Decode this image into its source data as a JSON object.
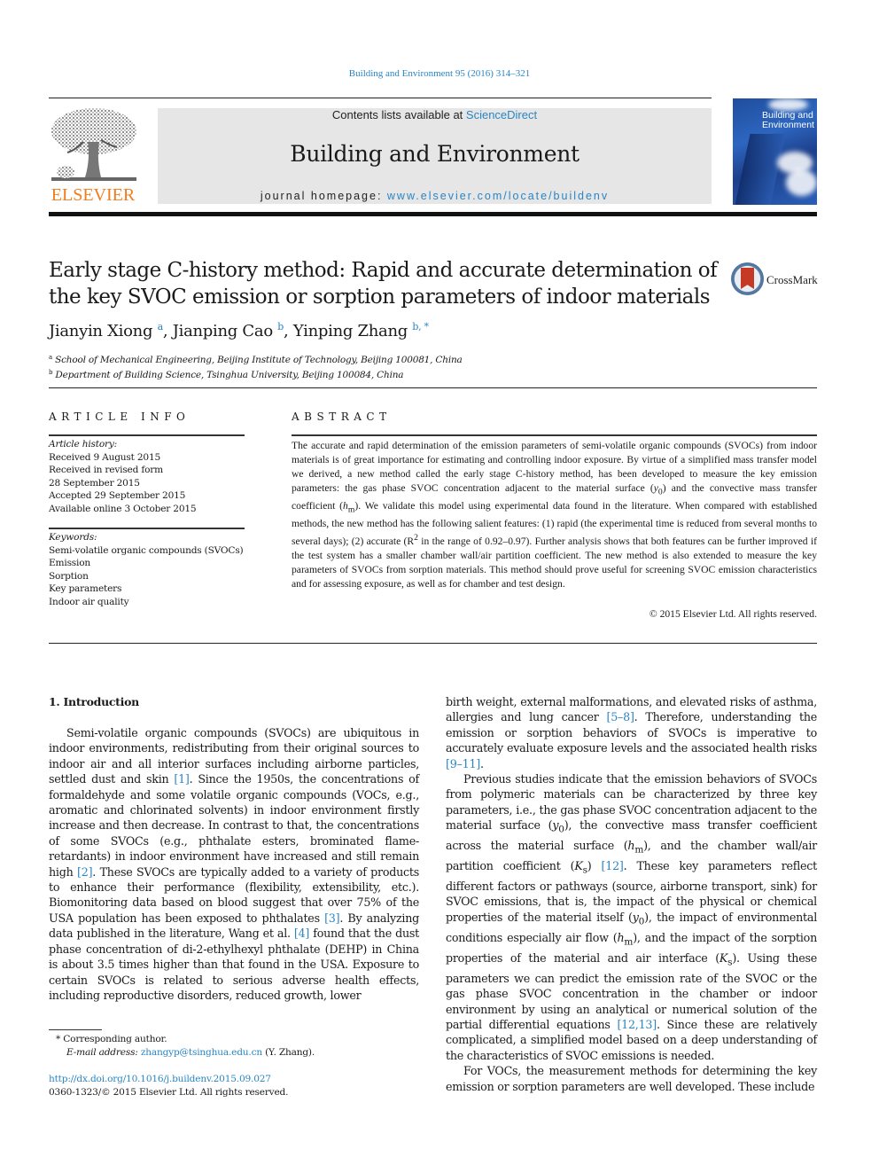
{
  "header": {
    "journal_ref": "Building and Environment 95 (2016) 314–321",
    "contents_prefix": "Contents lists available at ",
    "contents_link": "ScienceDirect",
    "journal_title": "Building and Environment",
    "homepage_prefix": "journal homepage: ",
    "homepage_link": "www.elsevier.com/locate/buildenv",
    "publisher_wordmark": "ELSEVIER",
    "cover_title_line1": "Building and",
    "cover_title_line2": "Environment",
    "crossmark_label": "CrossMark"
  },
  "article": {
    "title": "Early stage C-history method: Rapid and accurate determination of the key SVOC emission or sorption parameters of indoor materials",
    "authors": [
      {
        "name": "Jianyin Xiong",
        "sup": "a"
      },
      {
        "name": "Jianping Cao",
        "sup": "b"
      },
      {
        "name": "Yinping Zhang",
        "sup": "b, *"
      }
    ],
    "affiliations": [
      {
        "sup": "a",
        "text": "School of Mechanical Engineering, Beijing Institute of Technology, Beijing 100081, China"
      },
      {
        "sup": "b",
        "text": "Department of Building Science, Tsinghua University, Beijing 100084, China"
      }
    ]
  },
  "article_info": {
    "heading": "ARTICLE INFO",
    "history_label": "Article history:",
    "history": [
      "Received 9 August 2015",
      "Received in revised form",
      "28 September 2015",
      "Accepted 29 September 2015",
      "Available online 3 October 2015"
    ],
    "keywords_label": "Keywords:",
    "keywords": [
      "Semi-volatile organic compounds (SVOCs)",
      "Emission",
      "Sorption",
      "Key parameters",
      "Indoor air quality"
    ]
  },
  "abstract": {
    "heading": "ABSTRACT",
    "p1": "The accurate and rapid determination of the emission parameters of semi-volatile organic compounds (SVOCs) from indoor materials is of great importance for estimating and controlling indoor exposure. By virtue of a simplified mass transfer model we derived, a new method called the early stage C-history method, has been developed to measure the key emission parameters: the gas phase SVOC concentration adjacent to the material surface (",
    "y0": "y",
    "y0_sub": "0",
    "p2": ") and the convective mass transfer coefficient (",
    "hm": "h",
    "hm_sub": "m",
    "p3": "). We validate this model using experimental data found in the literature. When compared with established methods, the new method has the following salient features: (1) rapid (the experimental time is reduced from several months to several days); (2) accurate (R",
    "r2_sup": "2",
    "p4": " in the range of 0.92–0.97). Further analysis shows that both features can be further improved if the test system has a smaller chamber wall/air partition coefficient. The new method is also extended to measure the key parameters of SVOCs from sorption materials. This method should prove useful for screening SVOC emission characteristics and for assessing exposure, as well as for chamber and test design.",
    "copyright": "© 2015 Elsevier Ltd. All rights reserved."
  },
  "introduction": {
    "heading": "1.  Introduction",
    "left": {
      "a1": "Semi-volatile organic compounds (SVOCs) are ubiquitous in indoor environments, redistributing from their original sources to indoor air and all interior surfaces including airborne particles, settled dust and skin ",
      "r1": "[1]",
      "a2": ". Since the 1950s, the concentrations of formaldehyde and some volatile organic compounds (VOCs, e.g., aromatic and chlorinated solvents) in indoor environment firstly increase and then decrease. In contrast to that, the concentrations of some SVOCs (e.g., phthalate esters, brominated flame-retardants) in indoor environment have increased and still remain high ",
      "r2": "[2]",
      "a3": ". These SVOCs are typically added to a variety of products to enhance their performance (flexibility, extensibility, etc.). Biomonitoring data based on blood suggest that over 75% of the USA population has been exposed to phthalates ",
      "r3": "[3]",
      "a4": ". By analyzing data published in the literature, Wang et al. ",
      "r4": "[4]",
      "a5": " found that the dust phase concentration of di-2-ethylhexyl phthalate (DEHP) in China is about 3.5 times higher than that found in the USA. Exposure to certain SVOCs is related to serious adverse health effects, including reproductive disorders, reduced growth, lower"
    },
    "right": {
      "b1": "birth weight, external malformations, and elevated risks of asthma, allergies and lung cancer ",
      "r58": "[5–8]",
      "b2": ". Therefore, understanding the emission or sorption behaviors of SVOCs is imperative to accurately evaluate exposure levels and the associated health risks ",
      "r911": "[9–11]",
      "b3": ".",
      "c1": "Previous studies indicate that the emission behaviors of SVOCs from polymeric materials can be characterized by three key parameters, i.e., the gas phase SVOC concentration adjacent to the material surface (",
      "c2": "), the convective mass transfer coefficient across the material surface (",
      "c3": "), and the chamber wall/air partition coefficient (",
      "c4": ") ",
      "r12": "[12]",
      "c5": ". These key parameters reflect different factors or pathways (source, airborne transport, sink) for SVOC emissions, that is, the impact of the physical or chemical properties of the material itself (",
      "c6": "), the impact of environmental conditions especially air flow (",
      "c7": "), and the impact of the sorption properties of the material and air interface (",
      "c8": "). Using these parameters we can predict the emission rate of the SVOC or the gas phase SVOC concentration in the chamber or indoor environment by using an analytical or numerical solution of the partial differential equations ",
      "r1213": "[12,13]",
      "c9": ". Since these are relatively complicated, a simplified model based on a deep understanding of the characteristics of SVOC emissions is needed.",
      "d1": "For VOCs, the measurement methods for determining the key emission or sorption parameters are well developed. These include",
      "y": "y",
      "y_sub": "0",
      "h": "h",
      "h_sub": "m",
      "k": "K",
      "k_sub": "s"
    }
  },
  "footnotes": {
    "corresponding": "* Corresponding author.",
    "email_label": "E-mail address: ",
    "email": "zhangyp@tsinghua.edu.cn",
    "email_suffix": " (Y. Zhang).",
    "doi": "http://dx.doi.org/10.1016/j.buildenv.2015.09.027",
    "issn_line": "0360-1323/© 2015 Elsevier Ltd. All rights reserved."
  }
}
